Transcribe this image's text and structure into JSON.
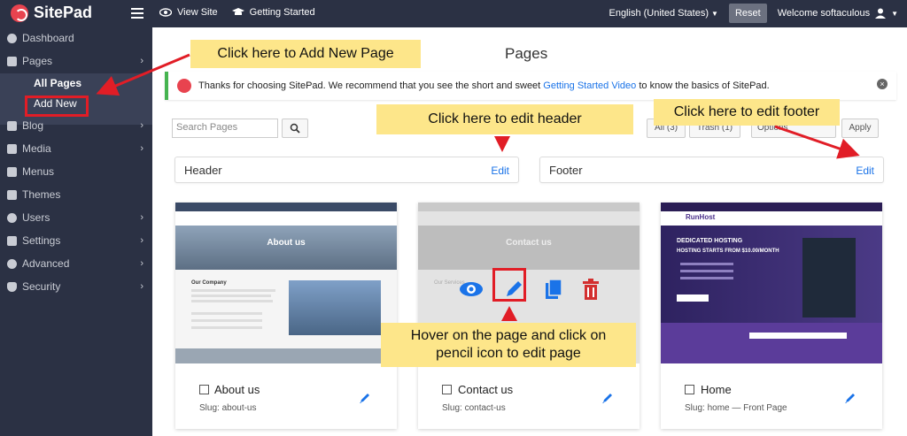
{
  "topbar": {
    "brand": "SitePad",
    "view_site": "View Site",
    "getting_started": "Getting Started",
    "language": "English (United States)",
    "reset": "Reset",
    "welcome": "Welcome softaculous"
  },
  "sidebar": {
    "items": [
      {
        "label": "Dashboard"
      },
      {
        "label": "Pages"
      },
      {
        "label": "Blog"
      },
      {
        "label": "Media"
      },
      {
        "label": "Menus"
      },
      {
        "label": "Themes"
      },
      {
        "label": "Users"
      },
      {
        "label": "Settings"
      },
      {
        "label": "Advanced"
      },
      {
        "label": "Security"
      }
    ],
    "sub": {
      "all_pages": "All Pages",
      "add_new": "Add New"
    }
  },
  "main": {
    "title": "Pages",
    "notice": {
      "text_before": "Thanks for choosing SitePad. We recommend that you see the short and sweet",
      "link": "Getting Started Video",
      "text_after": "to know the basics of SitePad."
    },
    "search_placeholder": "Search Pages",
    "filters": {
      "all": "All (3)",
      "trash": "Trash (1)",
      "options": "Options",
      "apply": "Apply"
    },
    "header_label": "Header",
    "footer_label": "Footer",
    "edit_label": "Edit",
    "cards": [
      {
        "title": "About us",
        "slug": "Slug: about-us",
        "hero": "About us",
        "section": "Our Company"
      },
      {
        "title": "Contact us",
        "slug": "Slug: contact-us",
        "hero": "Contact us",
        "section": "Our Services"
      },
      {
        "title": "Home",
        "slug": "Slug: home — Front Page",
        "brand": "RunHost",
        "hero": "DEDICATED HOSTING",
        "sub": "HOSTING STARTS FROM $10.00/MONTH"
      }
    ]
  },
  "callouts": {
    "add_new": "Click here to Add New Page",
    "edit_header": "Click here to edit header",
    "edit_footer": "Click here to edit footer",
    "hover": "Hover on the page and click on pencil icon to edit page"
  },
  "colors": {
    "sidebar": "#2b3144",
    "accent_red": "#e11d26",
    "callout": "#fde68a",
    "link": "#1a73e8",
    "notice": "#46b450"
  }
}
